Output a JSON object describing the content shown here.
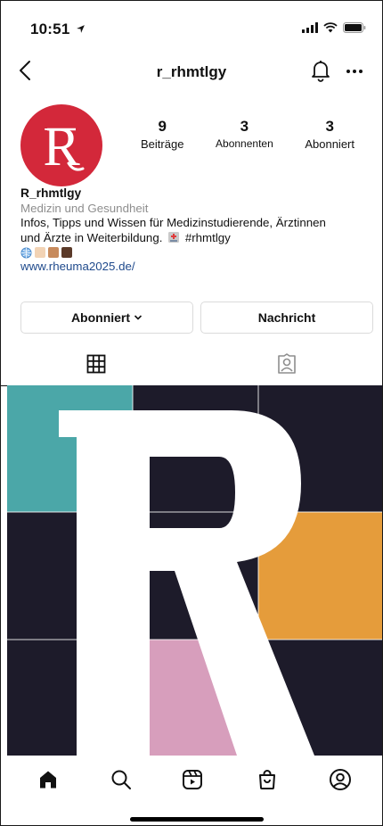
{
  "status_bar": {
    "time": "10:51"
  },
  "nav": {
    "username": "r_rhmtlgy",
    "icons": [
      "back-chevron-icon",
      "bell-icon",
      "more-horizontal-icon"
    ]
  },
  "profile": {
    "avatar_letter": "R",
    "avatar_color": "#d3283a",
    "stats": [
      {
        "value": "9",
        "label": "Beiträge"
      },
      {
        "value": "3",
        "label": "Abonnenten"
      },
      {
        "value": "3",
        "label": "Abonniert"
      }
    ],
    "name": "R_rhmtlgy",
    "category": "Medizin und Gesundheit",
    "bio_line1": "Infos, Tipps und Wissen für Medizinstudierende, Ärztinnen",
    "bio_line2_prefix": "und Ärzte in Weiterbildung.",
    "bio_line2_suffix": "#rhmtlgy",
    "link": "www.rheuma2025.de/"
  },
  "actions": {
    "follow_label": "Abonniert",
    "message_label": "Nachricht"
  },
  "tabs": [
    {
      "name": "grid",
      "icon": "grid-icon",
      "active": true
    },
    {
      "name": "tagged",
      "icon": "tagged-person-icon",
      "active": false
    }
  ],
  "grid": {
    "letter": "R",
    "colors": {
      "dark": "#1d1b2a",
      "teal": "#4ba7a8",
      "orange": "#e59c3b",
      "pink": "#d79ebc",
      "white": "#ffffff"
    }
  },
  "bottom_nav": [
    "home-icon",
    "search-icon",
    "reels-icon",
    "shop-icon",
    "profile-icon"
  ]
}
